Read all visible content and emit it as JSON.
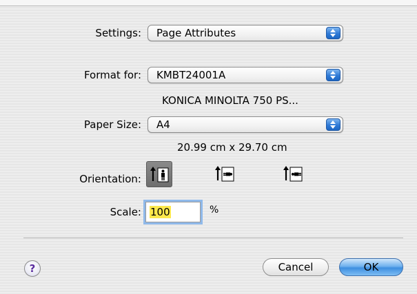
{
  "settings": {
    "label": "Settings:",
    "value": "Page Attributes"
  },
  "format_for": {
    "label": "Format for:",
    "value": "KMBT24001A",
    "printer_desc": "KONICA MINOLTA 750 PS..."
  },
  "paper_size": {
    "label": "Paper Size:",
    "value": "A4",
    "dimensions": "20.99 cm x 29.70 cm"
  },
  "orientation": {
    "label": "Orientation:",
    "options": [
      "portrait",
      "landscape-left",
      "landscape-right"
    ],
    "selected": "portrait"
  },
  "scale": {
    "label": "Scale:",
    "value": "100",
    "unit": "%"
  },
  "buttons": {
    "help": "?",
    "cancel": "Cancel",
    "ok": "OK"
  }
}
